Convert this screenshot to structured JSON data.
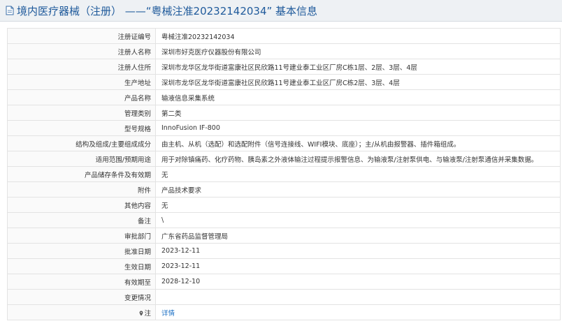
{
  "header": {
    "title": "境内医疗器械（注册） ——“粤械注准20232142034” 基本信息"
  },
  "fields": [
    {
      "label": "注册证编号",
      "value": "粤械注准20232142034"
    },
    {
      "label": "注册人名称",
      "value": "深圳市好克医疗仪器股份有限公司"
    },
    {
      "label": "注册人住所",
      "value": "深圳市龙华区龙华街道富康社区民欣路11号建业泰工业区厂房C栋1层、2层、3层、4层"
    },
    {
      "label": "生产地址",
      "value": "深圳市龙华区龙华街道富康社区民欣路11号建业泰工业区厂房C栋2层、3层、4层"
    },
    {
      "label": "产品名称",
      "value": "输液信息采集系统"
    },
    {
      "label": "管理类别",
      "value": "第二类"
    },
    {
      "label": "型号规格",
      "value": "InnoFusion IF-800"
    },
    {
      "label": "结构及组成/主要组成成分",
      "value": "由主机、从机（选配）和选配附件（信号连接线、WIFI模块、底座）；主/从机由报警器、插件箱组成。"
    },
    {
      "label": "适用范围/预期用途",
      "value": "用于对除镇痛药、化疗药物、胰岛素之外液体输注过程提示报警信息、为输液泵/注射泵供电、与输液泵/注射泵通信并采集数据。"
    },
    {
      "label": "产品储存条件及有效期",
      "value": "无"
    },
    {
      "label": "附件",
      "value": "产品技术要求"
    },
    {
      "label": "其他内容",
      "value": "无"
    },
    {
      "label": "备注",
      "value": "\\"
    },
    {
      "label": "审批部门",
      "value": "广东省药品监督管理局"
    },
    {
      "label": "批准日期",
      "value": "2023-12-11"
    },
    {
      "label": "生效日期",
      "value": "2023-12-11"
    },
    {
      "label": "有效期至",
      "value": "2028-12-10"
    },
    {
      "label": "变更情况",
      "value": ""
    }
  ],
  "note_row": {
    "label": "注",
    "link_text": "详情"
  },
  "colors": {
    "title": "#1f5a9b",
    "link": "#1a6fc4",
    "header_bg": "#eef1f4"
  },
  "icons": {
    "title_icon": "document-icon",
    "note_icon": "map-pin-icon"
  }
}
